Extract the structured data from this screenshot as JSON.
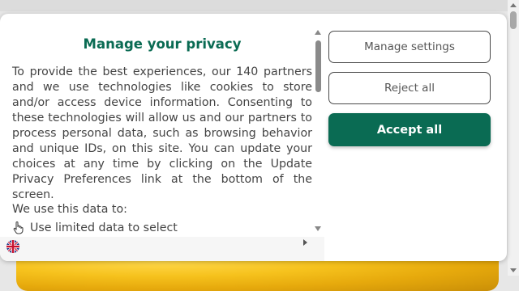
{
  "dialog": {
    "title": "Manage your privacy",
    "body": "To provide the best experiences, our 140 partners and we use technologies like cookies to store and/or access device information. Consenting to these technologies will allow us and our partners to process personal data, such as browsing behavior and unique IDs, on this site. You can update your choices at any time by clicking on the Update Privacy Preferences link at the bottom of the screen.",
    "use_heading": "We use this data to:",
    "use_items": [
      {
        "icon": "hand-pointer-icon",
        "label": "Use limited data to select"
      }
    ],
    "language": {
      "icon": "uk-flag-icon"
    }
  },
  "buttons": {
    "manage_label": "Manage settings",
    "reject_label": "Reject all",
    "accept_label": "Accept all"
  },
  "colors": {
    "accent": "#0a6b53",
    "text": "#444444"
  }
}
